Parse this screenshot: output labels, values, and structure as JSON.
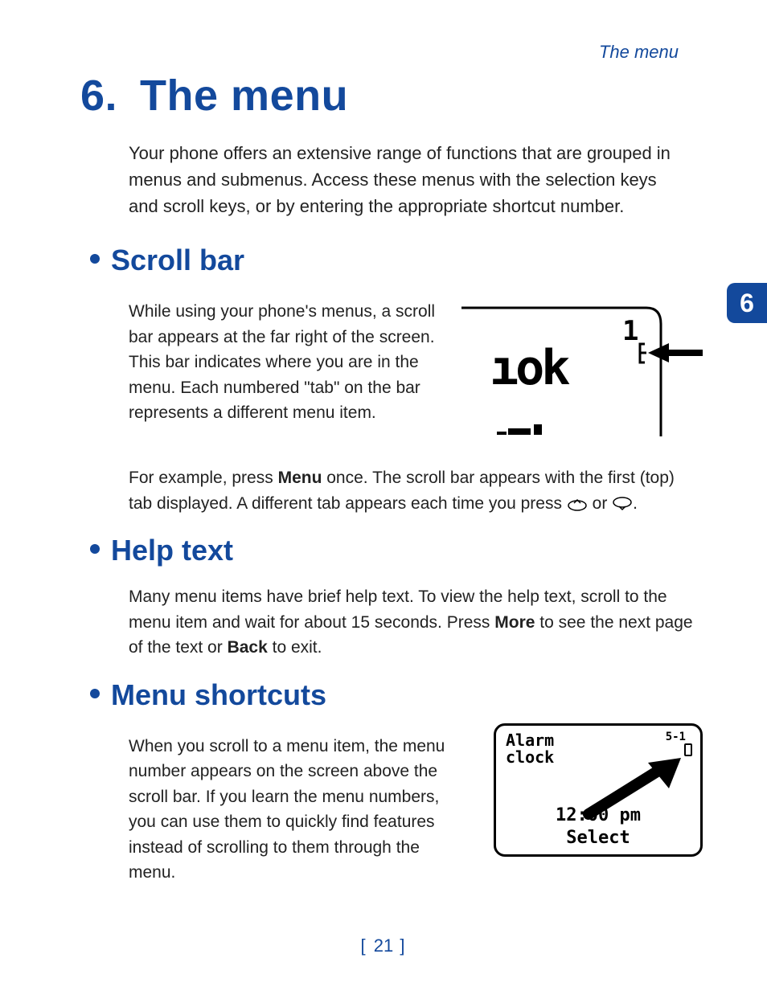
{
  "runningHead": "The menu",
  "chapter": {
    "number": "6.",
    "title": "The menu",
    "tabNumber": "6"
  },
  "intro": "Your phone offers an extensive range of functions that are grouped in menus and submenus. Access these menus with the selection keys and scroll keys, or by entering the appropriate shortcut number.",
  "sections": {
    "scrollBar": {
      "heading": "Scroll bar",
      "para1": "While using your phone's menus, a scroll bar appears at the far right of the screen. This bar indicates where you are in the menu. Each numbered \"tab\" on the bar represents a different menu item.",
      "para2_a": "For example, press ",
      "para2_menu": "Menu",
      "para2_b": " once. The scroll bar appears with the first (top) tab displayed. A different tab appears each time you press ",
      "para2_or": " or ",
      "para2_end": ".",
      "figure": {
        "tabNumber": "1",
        "lcdFragment": "ok"
      }
    },
    "helpText": {
      "heading": "Help text",
      "para_a": "Many menu items have brief help text. To view the help text, scroll to the menu item and wait for about 15 seconds. Press ",
      "para_more": "More",
      "para_b": " to see the next page of the text or ",
      "para_back": "Back",
      "para_c": " to exit."
    },
    "menuShortcuts": {
      "heading": "Menu shortcuts",
      "para": "When you scroll to a menu item, the menu number appears on the screen above the scroll bar. If you learn the menu numbers, you can use them to quickly find features instead of scrolling to them through the menu.",
      "figure": {
        "titleLine1": "Alarm",
        "titleLine2": "clock",
        "menuNumber": "5-1",
        "time": "12:00 pm",
        "softkey": "Select"
      }
    }
  },
  "pageNumber": "21"
}
